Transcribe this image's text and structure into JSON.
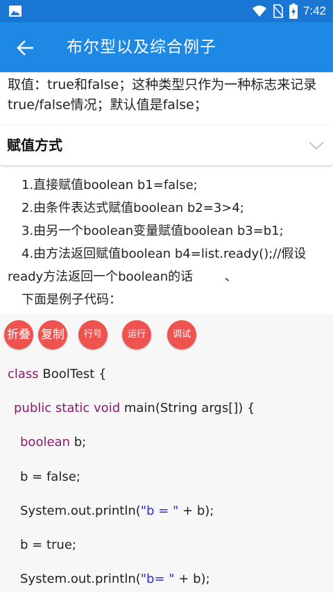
{
  "status_bar": {
    "time": "7:42"
  },
  "app_bar": {
    "title": "布尔型以及综合例子"
  },
  "intro": {
    "line1": "取值：true和false；这种类型只作为一种标志来记录",
    "line2": "true/false情况；默认值是false；"
  },
  "section": {
    "title": "赋值方式"
  },
  "content": {
    "l1": "1.直接赋值boolean b1=false;",
    "l2": "2.由条件表达式赋值boolean b2=3>4;",
    "l3": "3.由另一个boolean变量赋值boolean b3=b1;",
    "l4": "4.由方法返回赋值boolean b4=list.ready();//假设",
    "l5": "ready方法返回一个boolean的话        、",
    "l6": "下面是例子代码："
  },
  "code_buttons": {
    "fold": "折叠",
    "copy": "复制",
    "line_no": "行号",
    "run": "运行",
    "debug": "调试"
  },
  "code": {
    "l1_kw": "class",
    "l1_rest": " BoolTest {",
    "l2_kw": "public static void",
    "l2_rest": " main(String args[]) {",
    "l3_kw": "boolean",
    "l3_rest": " b;",
    "l4": "b = false;",
    "l5_pre": "System.out.println(",
    "l5_str": "\"b = \"",
    "l5_post": " + b);",
    "l6": "b = true;",
    "l7_pre": "System.out.println(",
    "l7_str": "\"b= \"",
    "l7_post": " + b);"
  },
  "colors": {
    "status_bar": "#1976d2",
    "app_bar": "#1e88e5",
    "button": "#ef5350",
    "keyword": "#8b1a6b",
    "string": "#2d2dd6"
  },
  "icons": {
    "status_left": "image-icon",
    "status_right": [
      "wifi-icon",
      "no-sim-icon",
      "battery-charging-icon"
    ],
    "back": "arrow-back-icon",
    "section": "chevron-down-icon"
  }
}
